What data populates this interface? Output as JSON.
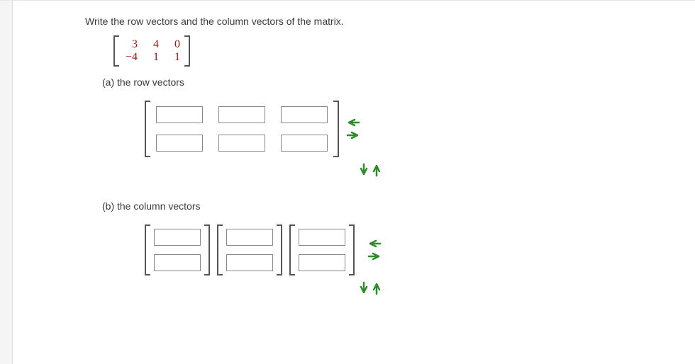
{
  "prompt": "Write the row vectors and the column vectors of the matrix.",
  "matrix": {
    "r1c1": "3",
    "r1c2": "4",
    "r1c3": "0",
    "r2c1": "−4",
    "r2c2": "1",
    "r2c3": "1"
  },
  "parts": {
    "a_label": "(a) the row vectors",
    "b_label": "(b) the column vectors"
  },
  "inputs": {
    "row_a": [
      "",
      "",
      ""
    ],
    "row_b": [
      "",
      "",
      ""
    ],
    "col1": [
      "",
      ""
    ],
    "col2": [
      "",
      ""
    ],
    "col3": [
      "",
      ""
    ]
  },
  "icons": {
    "arrow_left": "arrow-left-icon",
    "arrow_right": "arrow-right-icon",
    "arrow_down": "arrow-down-icon",
    "arrow_up": "arrow-up-icon"
  }
}
